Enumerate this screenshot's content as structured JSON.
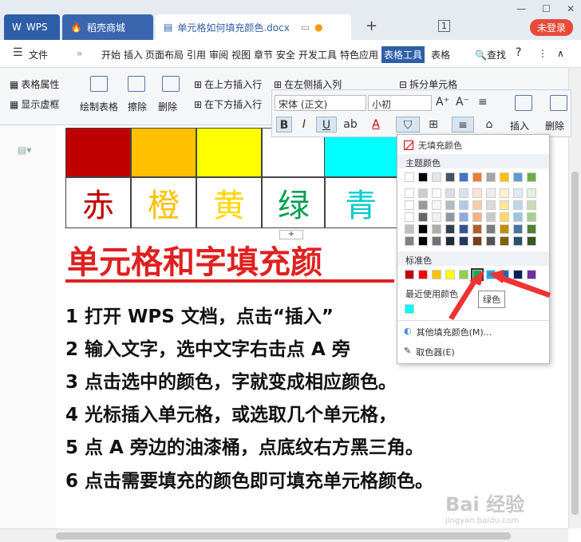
{
  "titlebar": {
    "wps": "WPS",
    "store": "稻壳商城",
    "doc": "单元格如何填充颜色.docx",
    "page_num": "1",
    "login": "未登录"
  },
  "menubar": {
    "file": "文件",
    "items": [
      "开始",
      "插入",
      "页面布局",
      "引用",
      "审阅",
      "视图",
      "章节",
      "安全",
      "开发工具",
      "特色应用",
      "表格工具",
      "表格"
    ],
    "search": "查找",
    "help": "?"
  },
  "ribbon": {
    "table_props": "表格属性",
    "show_grid": "显示虚框",
    "draw_table": "绘制表格",
    "erase": "擦除",
    "delete": "删除",
    "insert_above": "在上方插入行",
    "insert_below": "在下方插入行",
    "insert_left": "在左侧插入列",
    "split_cell": "拆分单元格",
    "insert": "插入",
    "delete2": "删除"
  },
  "format": {
    "font": "宋体 (正文)",
    "size": "小初",
    "bold": "B",
    "italic": "I",
    "underline": "U"
  },
  "document": {
    "colors": [
      "#c00000",
      "#ffc000",
      "#ffff00",
      "#ffffff",
      "#00ffff"
    ],
    "chars": [
      {
        "text": "赤",
        "color": "#c00000"
      },
      {
        "text": "橙",
        "color": "#ffc000"
      },
      {
        "text": "黄",
        "color": "#ffd700"
      },
      {
        "text": "绿",
        "color": "#00a050"
      },
      {
        "text": "青",
        "color": "#00cccc"
      }
    ],
    "heading": "单元格和字填充颜",
    "lines": [
      "1 打开 WPS 文档，点击“插入”",
      "2 输入文字，选中文字右击点 A 旁",
      "3 点击选中的颜色，字就变成相应颜色。",
      "4 光标插入单元格，或选取几个单元格，",
      "5 点 A 旁边的油漆桶，点底纹右方黑三角。",
      "6 点击需要填充的颜色即可填充单元格颜色。"
    ]
  },
  "popup": {
    "no_fill": "无填充颜色",
    "theme": "主题颜色",
    "standard": "标准色",
    "recent": "最近使用颜色",
    "more": "其他填充颜色(M)...",
    "picker": "取色器(E)",
    "tooltip": "绿色",
    "theme_top": [
      "#ffffff",
      "#000000",
      "#e7e6e6",
      "#44546a",
      "#4472c4",
      "#ed7d31",
      "#a5a5a5",
      "#ffc000",
      "#5b9bd5",
      "#70ad47"
    ],
    "standard_colors": [
      "#c00000",
      "#ff0000",
      "#ffc000",
      "#ffff00",
      "#92d050",
      "#00b050",
      "#00b0f0",
      "#0070c0",
      "#002060",
      "#7030a0"
    ],
    "recent_colors": [
      "#00ffff"
    ]
  },
  "watermark": {
    "main": "Bai 经验",
    "sub": "jingyan.baidu.com"
  }
}
